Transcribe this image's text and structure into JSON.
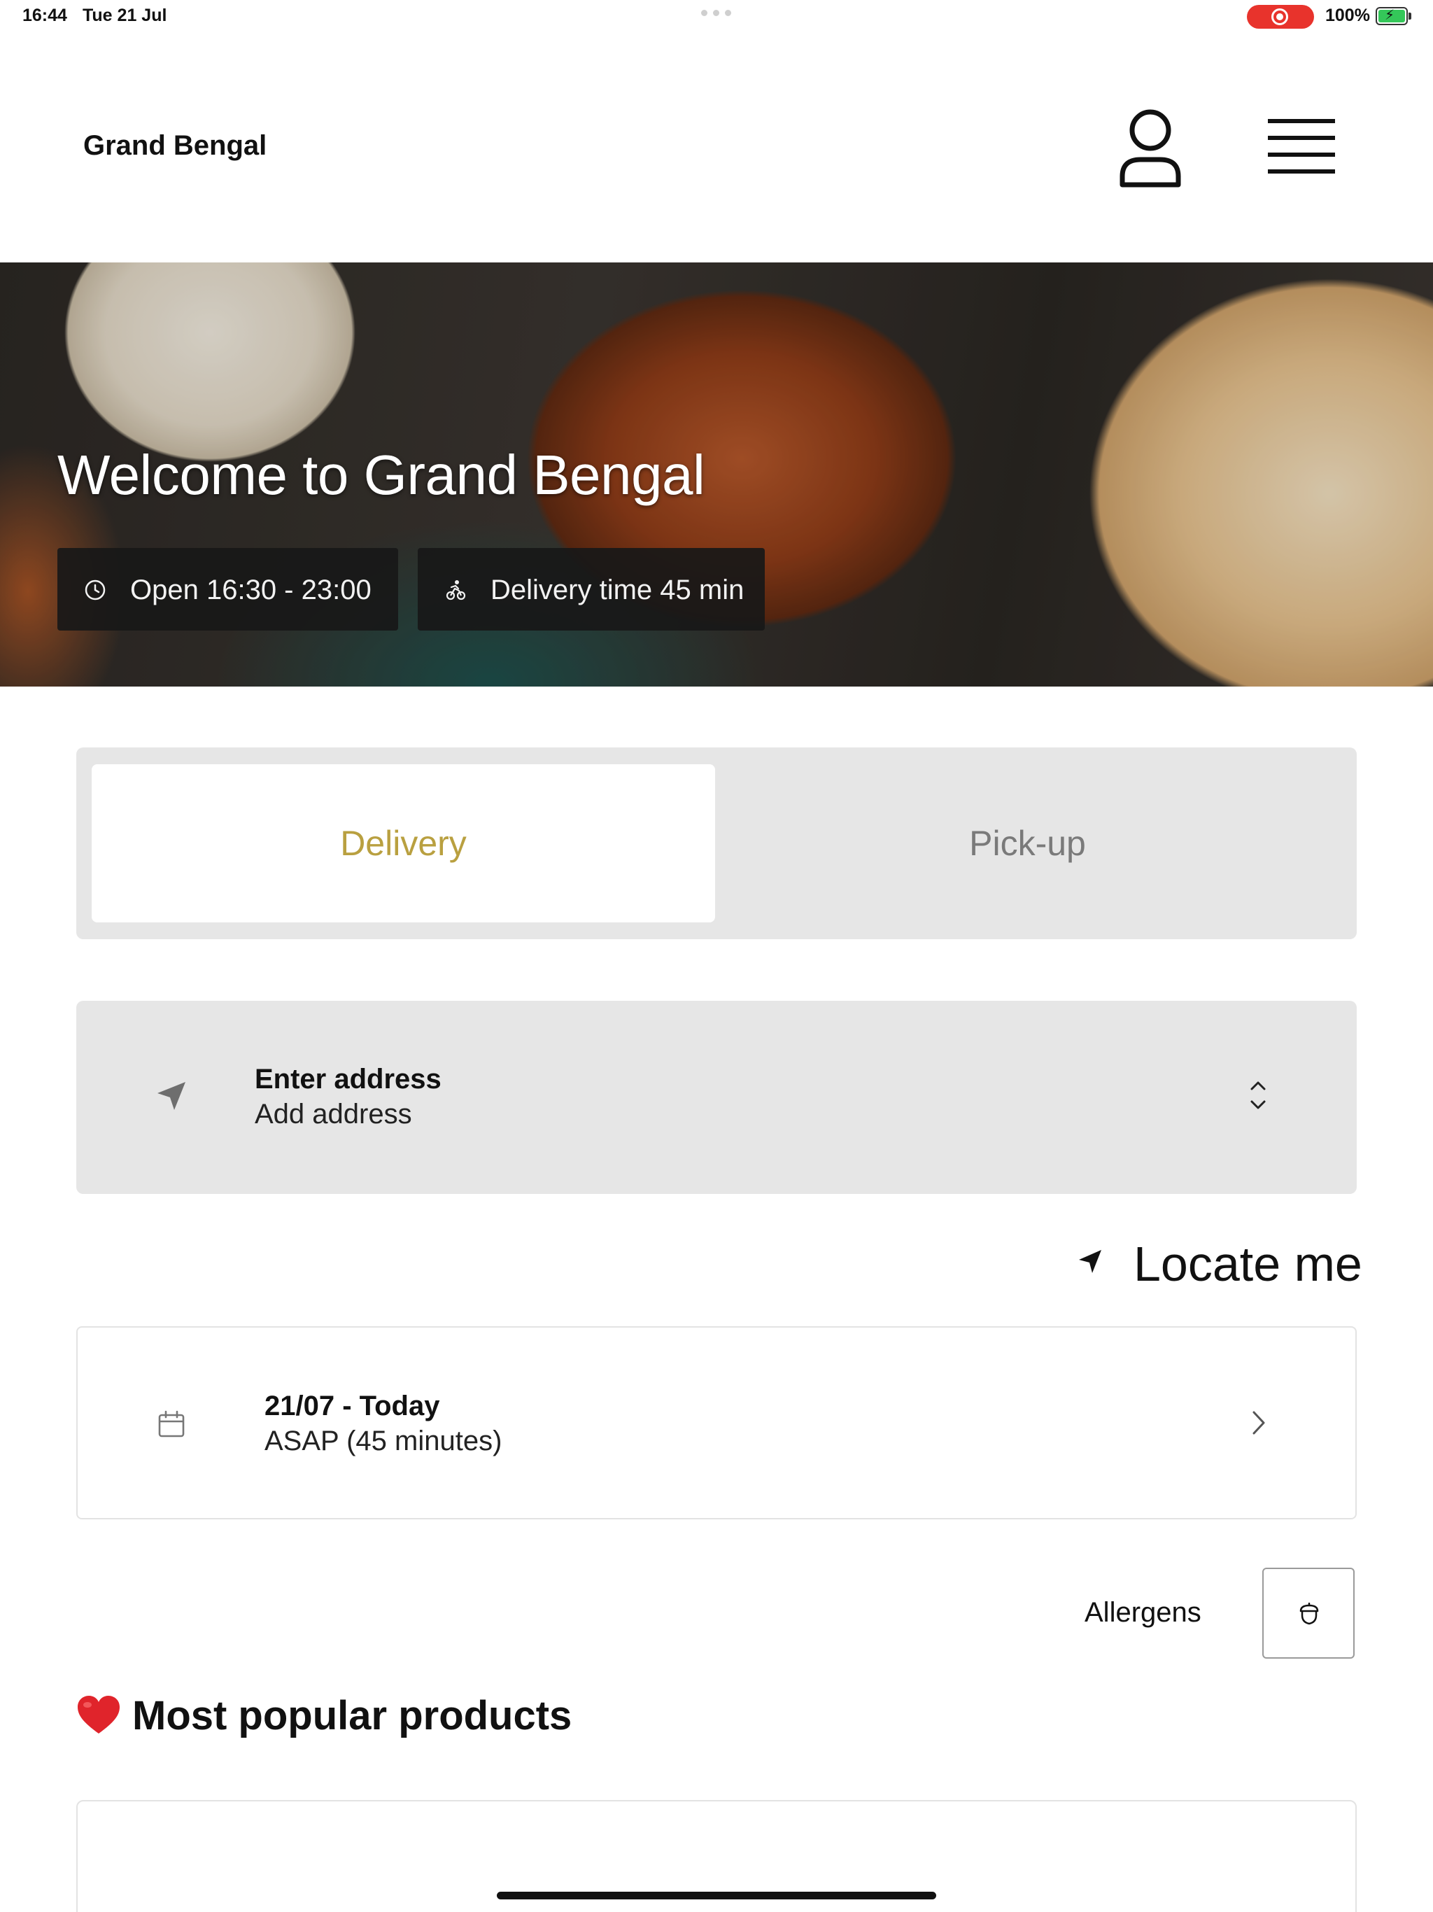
{
  "status_bar": {
    "time": "16:44",
    "date": "Tue 21 Jul",
    "battery_percent": "100%",
    "battery_level": 1.0,
    "recording_indicator_color": "#e8332c"
  },
  "header": {
    "brand": "Grand Bengal",
    "account_icon": "person-outline-icon",
    "menu_icon": "hamburger-menu-icon"
  },
  "hero": {
    "title": "Welcome to Grand Bengal",
    "hours_label": "Open 16:30 - 23:00",
    "hours_icon": "clock-icon",
    "delivery_label": "Delivery time 45 min",
    "delivery_icon": "bicycle-rider-icon"
  },
  "order_mode": {
    "tabs": [
      {
        "label": "Delivery",
        "active": true
      },
      {
        "label": "Pick-up",
        "active": false
      }
    ],
    "active_color": "#b9a040"
  },
  "address": {
    "title": "Enter address",
    "subtitle": "Add address",
    "icon": "navigation-arrow-icon",
    "chevron": "chevron-up-down-icon"
  },
  "locate": {
    "label": "Locate me",
    "icon": "location-arrow-icon"
  },
  "schedule": {
    "title": "21/07 - Today",
    "subtitle": "ASAP (45 minutes)",
    "icon": "calendar-icon",
    "chevron": "chevron-right-icon"
  },
  "allergens": {
    "label": "Allergens",
    "icon": "acorn-icon"
  },
  "popular": {
    "title": "Most popular products",
    "icon": "red-heart-icon"
  }
}
